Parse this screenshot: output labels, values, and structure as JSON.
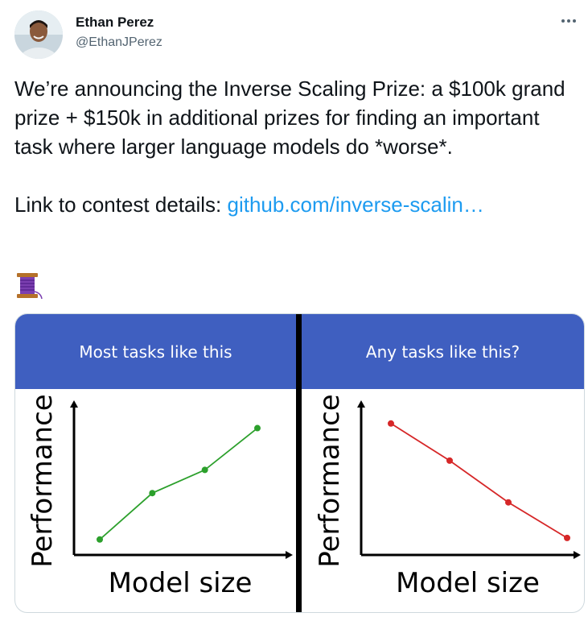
{
  "author": {
    "name": "Ethan Perez",
    "handle": "@EthanJPerez"
  },
  "tweet": {
    "text_main": "We’re announcing the Inverse Scaling Prize: a $100k grand prize + $150k in additional prizes for finding an important task where larger language models do *worse*.",
    "link_prefix": "Link to contest details: ",
    "link_text": "github.com/inverse-scalin…"
  },
  "icons": {
    "avatar": "profile-photo",
    "more": "more-dots-icon",
    "thread": "spool-of-thread-icon"
  },
  "colors": {
    "header_bg": "#3f5fc0",
    "link": "#1d9bf0",
    "up_series": "#2ca02c",
    "down_series": "#d62728"
  },
  "chart_data": [
    {
      "type": "line",
      "title": "Most tasks like this",
      "xlabel": "Model size",
      "ylabel": "Performance",
      "x": [
        1,
        2,
        3,
        4
      ],
      "values": [
        1.0,
        4.0,
        5.5,
        8.2
      ],
      "color": "#2ca02c",
      "ylim": [
        0,
        10
      ],
      "xlim": [
        0,
        5
      ],
      "grid": false
    },
    {
      "type": "line",
      "title": "Any tasks like this?",
      "xlabel": "Model size",
      "ylabel": "Performance",
      "x": [
        1,
        2,
        3,
        4
      ],
      "values": [
        8.5,
        6.1,
        3.4,
        1.1
      ],
      "color": "#d62728",
      "ylim": [
        0,
        10
      ],
      "xlim": [
        0,
        5
      ],
      "grid": false
    }
  ]
}
